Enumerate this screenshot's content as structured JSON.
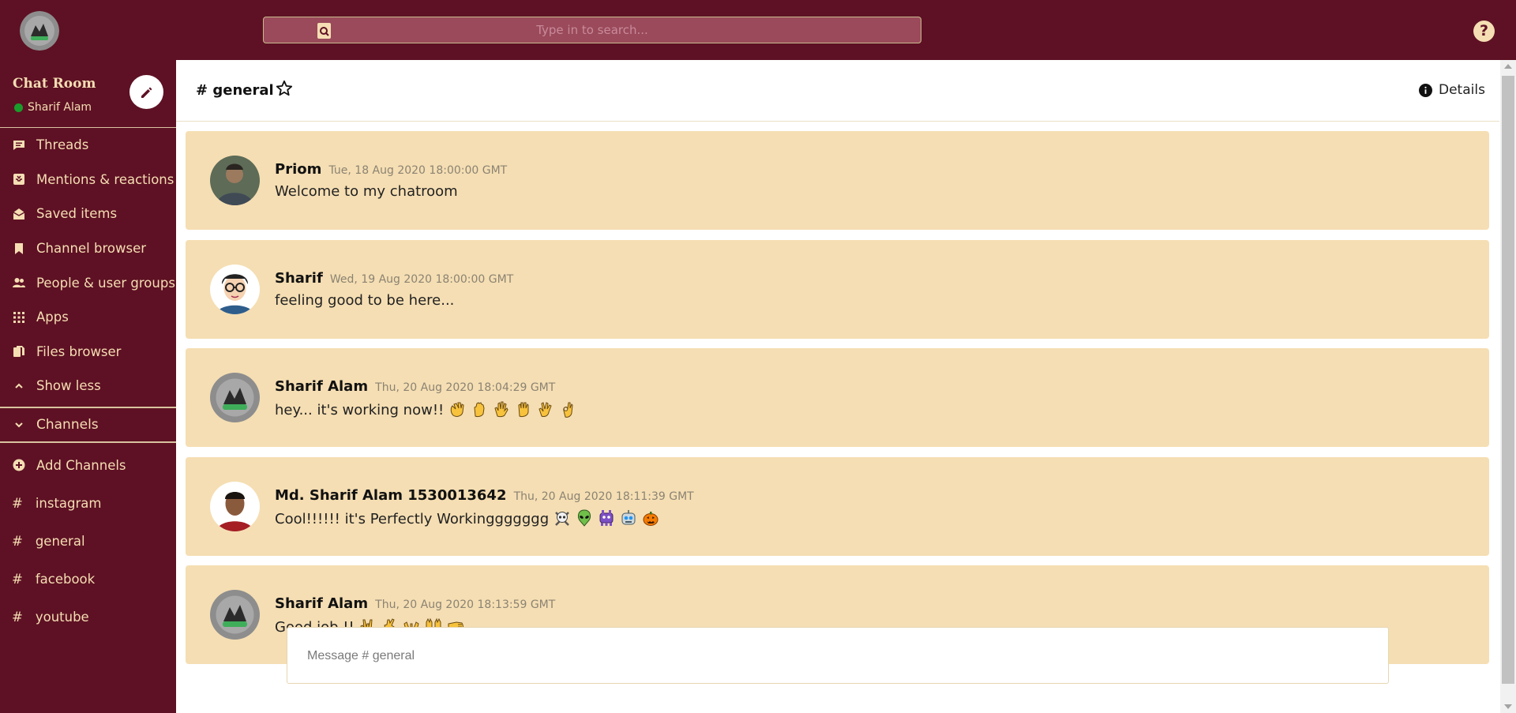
{
  "theme": {
    "primary": "#5e1124",
    "accent": "#f5deb3",
    "online": "#1a9c2c"
  },
  "search": {
    "placeholder": "Type in to search...",
    "icon": "search-icon"
  },
  "help": {
    "label": "?",
    "icon": "help-icon"
  },
  "workspace": {
    "name": "Chat Room",
    "user": "Sharif Alam",
    "edit_icon": "pencil-icon"
  },
  "sidebar": {
    "items": [
      {
        "label": "Threads",
        "icon": "threads-icon"
      },
      {
        "label": "Mentions & reactions",
        "icon": "mentions-icon"
      },
      {
        "label": "Saved items",
        "icon": "saved-icon"
      },
      {
        "label": "Channel browser",
        "icon": "bookmark-icon"
      },
      {
        "label": "People & user groups",
        "icon": "people-icon"
      },
      {
        "label": "Apps",
        "icon": "apps-icon"
      },
      {
        "label": "Files browser",
        "icon": "files-icon"
      },
      {
        "label": "Show less",
        "icon": "chevron-up-icon"
      }
    ],
    "channels_header": "Channels",
    "add_channels": "Add Channels",
    "channels": [
      {
        "hash": "#",
        "name": "instagram"
      },
      {
        "hash": "#",
        "name": "general"
      },
      {
        "hash": "#",
        "name": "facebook"
      },
      {
        "hash": "#",
        "name": "youtube"
      }
    ]
  },
  "channel": {
    "title": "# general",
    "details_label": "Details"
  },
  "messages": [
    {
      "author": "Priom",
      "time": "Tue, 18 Aug 2020 18:00:00 GMT",
      "text": "Welcome to my chatroom",
      "emojis": []
    },
    {
      "author": "Sharif",
      "time": "Wed, 19 Aug 2020 18:00:00 GMT",
      "text": "feeling good to be here...",
      "emojis": []
    },
    {
      "author": "Sharif Alam",
      "time": "Thu, 20 Aug 2020 18:04:29 GMT",
      "text": "hey... it's working now!! ",
      "emojis": [
        "👋",
        "🤚",
        "🖐",
        "✋",
        "🖖",
        "👌"
      ]
    },
    {
      "author": "Md. Sharif Alam 1530013642",
      "time": "Thu, 20 Aug 2020 18:11:39 GMT",
      "text": "Cool!!!!!! it's Perfectly Workinggggggg ",
      "emojis": [
        "☠",
        "👽",
        "👾",
        "🤖",
        "🎃"
      ]
    },
    {
      "author": "Sharif Alam",
      "time": "Thu, 20 Aug 2020 18:13:59 GMT",
      "text": "Good job !! ",
      "emojis": [
        "🤟",
        "🤞",
        "🤲",
        "🙌",
        "🤜"
      ]
    }
  ],
  "composer": {
    "placeholder": "Message # general"
  }
}
